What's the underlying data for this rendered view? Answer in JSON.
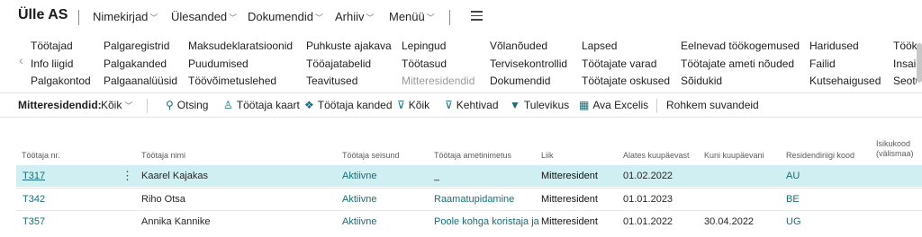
{
  "header": {
    "company": "Ülle AS",
    "menus": [
      {
        "label": "Nimekirjad",
        "has_chevron": true
      },
      {
        "label": "Ülesanded",
        "has_chevron": true
      },
      {
        "label": "Dokumendid",
        "has_chevron": true
      },
      {
        "label": "Arhiiv",
        "has_chevron": true
      },
      {
        "label": "Menüü",
        "has_chevron": true
      }
    ],
    "hamburger_icon": "hamburger-icon"
  },
  "links": {
    "columns": [
      [
        "Töötajad",
        "Info liigid",
        "Palgakontod"
      ],
      [
        "Palgaregistrid",
        "Palgakanded",
        "Palgaanalüüsid"
      ],
      [
        "Maksudeklaratsioonid",
        "Puudumised",
        "Töövõimetuslehed"
      ],
      [
        "Puhkuste ajakava",
        "Tööajatabelid",
        "Teavitused"
      ],
      [
        "Lepingud",
        "Töötasud",
        "Mitteresidendid"
      ],
      [
        "Võlanõuded",
        "Tervisekontrollid",
        "Dokumendid"
      ],
      [
        "Lapsed",
        "Töötajate varad",
        "Töötajate oskused"
      ],
      [
        "Eelnevad töökogemused",
        "Töötajate ameti nõuded",
        "Sõidukid"
      ],
      [
        "Haridused",
        "Failid",
        "Kutsehaigused"
      ],
      [
        "Tööke",
        "Insaid",
        "Seotu"
      ]
    ],
    "muted": [
      "Mitteresidendid"
    ]
  },
  "actionbar": {
    "page_label": "Mitteresidendid:",
    "filter_value": "Kõik",
    "actions": [
      {
        "label": "Otsing",
        "icon": "search-icon"
      },
      {
        "label": "Töötaja kaart",
        "icon": "person-icon"
      },
      {
        "label": "Töötaja kanded",
        "icon": "entries-icon"
      },
      {
        "label": "Kõik",
        "icon": "filter-clear-icon"
      },
      {
        "label": "Kehtivad",
        "icon": "filter-valid-icon"
      },
      {
        "label": "Tulevikus",
        "icon": "filter-icon"
      },
      {
        "label": "Ava Excelis",
        "icon": "excel-icon"
      }
    ],
    "more": "Rohkem suvandeid"
  },
  "table": {
    "headers": [
      "Töötaja nr.",
      "Töötaja nimi",
      "Töötaja seisund",
      "Töötaja ametinimetus",
      "Liik",
      "Alates kuupäevast",
      "Kuni kuupäevani",
      "Residendiriigi kood",
      "Isikukood (välismaa)"
    ],
    "rows": [
      {
        "nr": "T317",
        "name": "Kaarel Kajakas",
        "status": "Aktiivne",
        "title": "_",
        "type": "Mitteresident",
        "from": "01.02.2022",
        "to": "",
        "country": "AU",
        "selected": true
      },
      {
        "nr": "T342",
        "name": "Riho Otsa",
        "status": "Aktiivne",
        "title": "Raamatupidamine",
        "type": "Mitteresident",
        "from": "01.01.2023",
        "to": "",
        "country": "BE",
        "selected": false
      },
      {
        "nr": "T357",
        "name": "Annika Kannike",
        "status": "Aktiivne",
        "title": "Poole kohga koristaja ja...",
        "type": "Mitteresident",
        "from": "01.01.2022",
        "to": "30.04.2022",
        "country": "UG",
        "selected": false
      }
    ]
  },
  "colors": {
    "accent": "#1a6c74",
    "selected_row": "#cfeff2"
  }
}
